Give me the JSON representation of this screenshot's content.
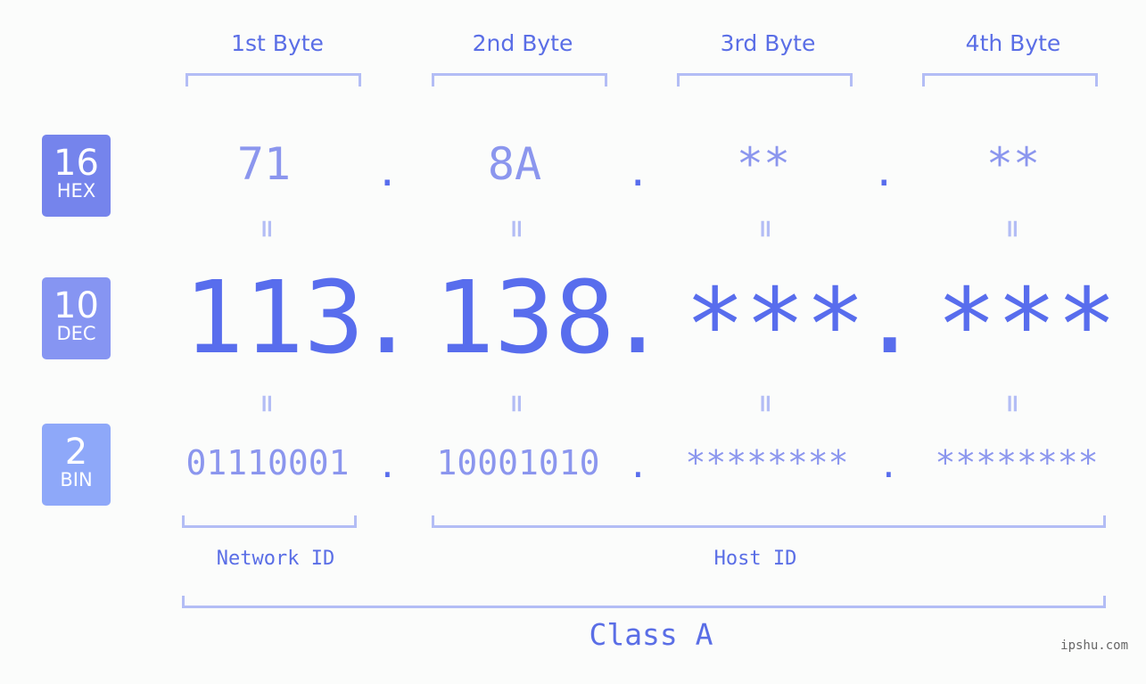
{
  "badges": [
    {
      "num": "16",
      "label": "HEX",
      "color": "#7584ec"
    },
    {
      "num": "10",
      "label": "DEC",
      "color": "#8695f2"
    },
    {
      "num": "2",
      "label": "BIN",
      "color": "#8ea8f9"
    }
  ],
  "byte_headers": [
    "1st Byte",
    "2nd Byte",
    "3rd Byte",
    "4th Byte"
  ],
  "hex": [
    "71",
    "8A",
    "**",
    "**"
  ],
  "dec": [
    "113",
    "138",
    "***",
    "***"
  ],
  "bin": [
    "01110001",
    "10001010",
    "********",
    "********"
  ],
  "separator": ".",
  "equals": "=",
  "network_id_label": "Network ID",
  "host_id_label": "Host ID",
  "class_label": "Class A",
  "watermark": "ipshu.com",
  "colors": {
    "accent": "#586ded",
    "light": "#8b96ee",
    "bracket": "#b3bdf5"
  }
}
